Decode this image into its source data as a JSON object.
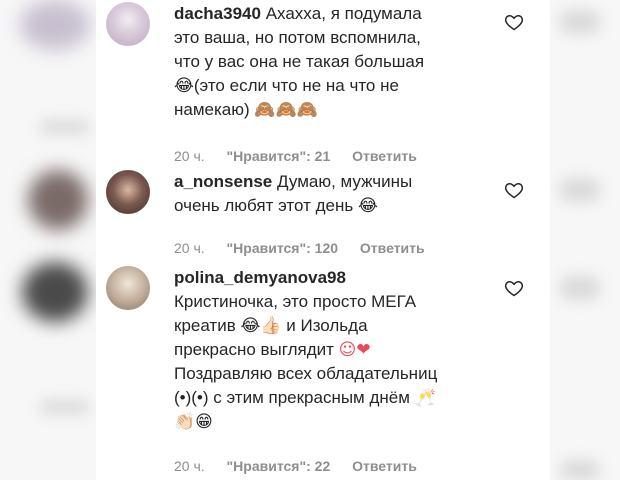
{
  "comments": [
    {
      "username": "dacha3940",
      "lines": [
        "Ахаххa, я подумала",
        "это ваша, но потом вспомнила,",
        "что у вас она не такая большая",
        "(это если что не на что не",
        "намекаю)"
      ],
      "emoji_line4_prefix": "😂",
      "emoji_line5_suffix": "🙈🙈🙈",
      "time": "20 ч.",
      "likes": "\"Нравится\": 21",
      "reply": "Ответить"
    },
    {
      "username": "a_nonsense",
      "lines": [
        "Думаю, мужчины",
        "очень любят этот день"
      ],
      "emoji_line2_suffix": "😂",
      "time": "20 ч.",
      "likes": "\"Нравится\": 120",
      "reply": "Ответить"
    },
    {
      "username": "polina_demyanova98",
      "lines": [
        "Кристиночка, это просто МЕГА",
        "креатив",
        "и Изольда",
        "прекрасно выглядит",
        "Поздравляю всех обладательниц",
        "(•)(•) с этим прекрасным днём"
      ],
      "emoji_kreativ": "😂👍🏻",
      "emoji_vyglyadit": "☺❤",
      "emoji_dnem": "🥂",
      "emoji_last_line": "👏🏻😁",
      "time": "20 ч.",
      "likes": "\"Нравится\": 22",
      "reply": "Ответить"
    }
  ],
  "colors": {
    "text": "#262626",
    "meta": "#8e8e8e",
    "heart": "#262626",
    "heart_red": "#ed4956"
  },
  "icons": [
    "heart-outline-icon",
    "avatar"
  ]
}
